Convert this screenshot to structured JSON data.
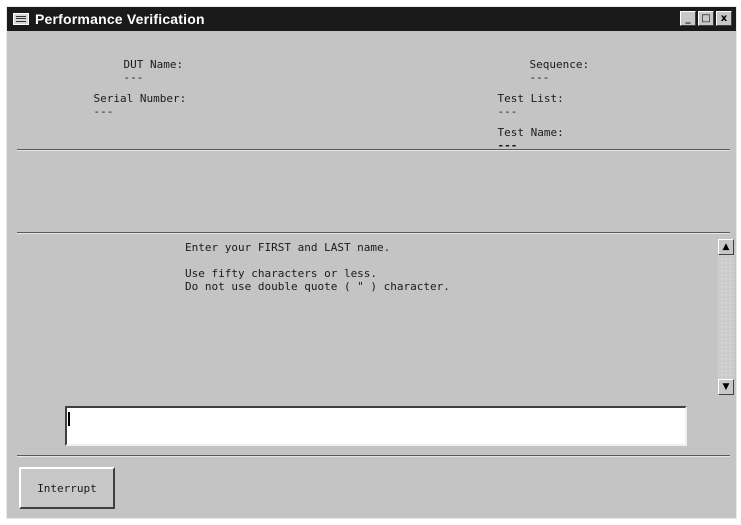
{
  "window": {
    "title": "Performance Verification",
    "controls": {
      "minimize": "_",
      "maximize": "□",
      "close": "x"
    }
  },
  "header_fields": {
    "dut_name": {
      "label": "DUT Name:",
      "value": "---"
    },
    "serial_number": {
      "label": "Serial Number:",
      "value": "---"
    },
    "sequence": {
      "label": "Sequence:",
      "value": "---"
    },
    "test_list": {
      "label": "Test List:",
      "value": "---"
    },
    "test_name": {
      "label": "Test Name:",
      "value": "---"
    }
  },
  "prompt": {
    "line1": "Enter your FIRST and LAST name.",
    "line2": "Use fifty characters or less.",
    "line3": "Do not use double quote ( \" ) character."
  },
  "scrollbar": {
    "up_arrow": "▲",
    "down_arrow": "▼"
  },
  "name_input": {
    "value": "",
    "placeholder": ""
  },
  "buttons": {
    "interrupt": "Interrupt"
  }
}
